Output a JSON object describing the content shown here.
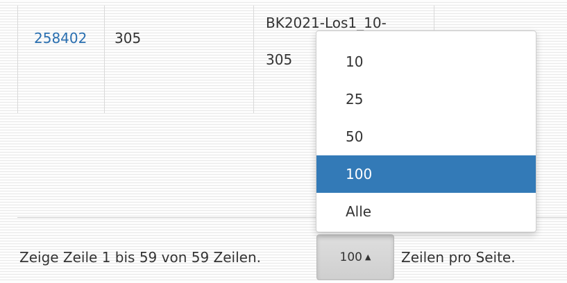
{
  "table": {
    "row": {
      "id": "258402",
      "col2": "305",
      "col3_line1": "BK2021-Los1_10-",
      "col3_line2": "305"
    }
  },
  "dropdown": {
    "options": [
      "10",
      "25",
      "50",
      "100",
      "Alle"
    ],
    "selected": "100"
  },
  "pagination": {
    "info_text": "Zeige Zeile 1 bis 59 von 59 Zeilen.",
    "page_size_value": "100",
    "caret": "▲",
    "per_page_text": "Zeilen pro Seite."
  }
}
